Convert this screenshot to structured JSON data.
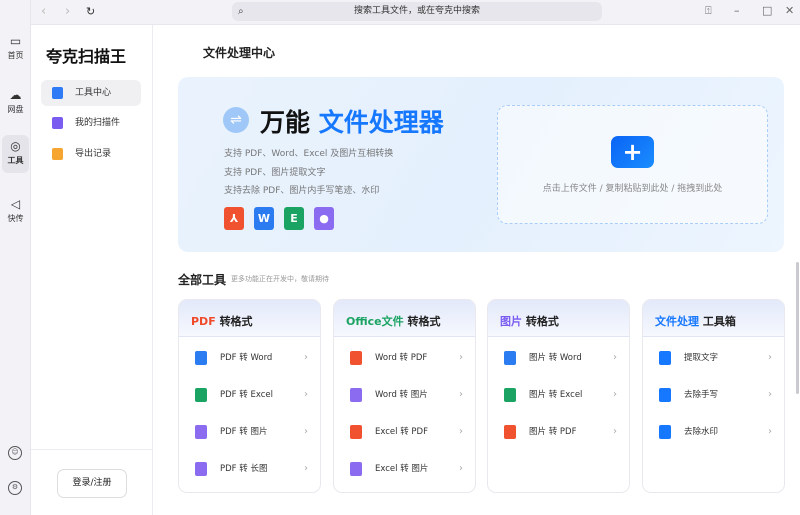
{
  "rail": {
    "items": [
      {
        "label": "首页",
        "icon": "home-icon"
      },
      {
        "label": "网盘",
        "icon": "cloud-icon"
      },
      {
        "label": "工具",
        "icon": "scan-icon"
      },
      {
        "label": "快传",
        "icon": "send-icon"
      }
    ]
  },
  "topbar": {
    "search_placeholder": "搜索工具文件，或在夸克中搜索"
  },
  "sidebar": {
    "title": "夸克扫描王",
    "items": [
      {
        "label": "工具中心"
      },
      {
        "label": "我的扫描件"
      },
      {
        "label": "导出记录"
      }
    ],
    "login": "登录/注册"
  },
  "main": {
    "heading": "文件处理中心",
    "hero": {
      "title_a": "万能",
      "title_b": "文件处理器",
      "lines": [
        "支持 PDF、Word、Excel 及图片互相转换",
        "支持 PDF、图片提取文字",
        "支持去除 PDF、图片内手写笔迹、水印"
      ],
      "file_icons": [
        "W",
        "E"
      ],
      "upload_text": "点击上传文件 / 复制粘贴到此处 / 拖拽到此处"
    },
    "tools_title": "全部工具",
    "tools_sub": "更多功能正在开发中，敬请期待",
    "cards": [
      {
        "accent": "PDF",
        "title": "转格式",
        "color": "#f04a2a",
        "rows": [
          "PDF 转 Word",
          "PDF 转 Excel",
          "PDF 转 图片",
          "PDF 转 长图"
        ]
      },
      {
        "accent": "Office文件",
        "title": "转格式",
        "color": "#1aa362",
        "rows": [
          "Word 转 PDF",
          "Word 转 图片",
          "Excel 转 PDF",
          "Excel 转 图片"
        ]
      },
      {
        "accent": "图片",
        "title": "转格式",
        "color": "#7b5cf0",
        "rows": [
          "图片 转 Word",
          "图片 转 Excel",
          "图片 转 PDF"
        ]
      },
      {
        "accent": "文件处理",
        "title": "工具箱",
        "color": "#1677ff",
        "rows": [
          "提取文字",
          "去除手写",
          "去除水印"
        ]
      }
    ]
  }
}
